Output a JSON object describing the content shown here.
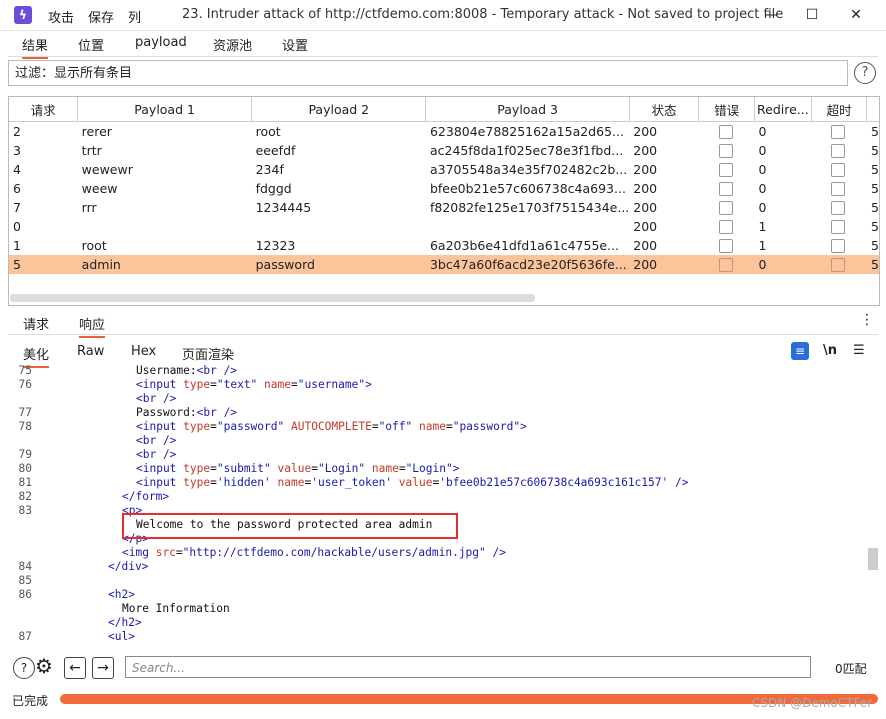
{
  "titlebar": {
    "menu": [
      "攻击",
      "保存",
      "列"
    ],
    "title": "23. Intruder attack of http://ctfdemo.com:8008 - Temporary attack - Not saved to project file",
    "min": "—",
    "max": "☐",
    "close": "✕"
  },
  "tabs": [
    "结果",
    "位置",
    "payload",
    "资源池",
    "设置"
  ],
  "filter": "过滤：显示所有条目",
  "table": {
    "headers": [
      "请求",
      "Payload 1",
      "Payload 2",
      "Payload 3",
      "状态",
      "错误",
      "Redire...",
      "超时"
    ],
    "rows": [
      {
        "req": "2",
        "p1": "rerer",
        "p2": "root",
        "p3": "623804e78825162a15a2d65...",
        "status": "200",
        "redir": "0",
        "extra": "5"
      },
      {
        "req": "3",
        "p1": "trtr",
        "p2": "eeefdf",
        "p3": "ac245f8da1f025ec78e3f1fbd...",
        "status": "200",
        "redir": "0",
        "extra": "5"
      },
      {
        "req": "4",
        "p1": "wewewr",
        "p2": "234f",
        "p3": "a3705548a34e35f702482c2b...",
        "status": "200",
        "redir": "0",
        "extra": "5"
      },
      {
        "req": "6",
        "p1": "weew",
        "p2": "fdggd",
        "p3": "bfee0b21e57c606738c4a693...",
        "status": "200",
        "redir": "0",
        "extra": "5"
      },
      {
        "req": "7",
        "p1": "rrr",
        "p2": "1234445",
        "p3": "f82082fe125e1703f7515434e...",
        "status": "200",
        "redir": "0",
        "extra": "5"
      },
      {
        "req": "0",
        "p1": "",
        "p2": "",
        "p3": "",
        "status": "200",
        "redir": "1",
        "extra": "5"
      },
      {
        "req": "1",
        "p1": "root",
        "p2": "12323",
        "p3": "6a203b6e41dfd1a61c4755e...",
        "status": "200",
        "redir": "1",
        "extra": "5"
      },
      {
        "req": "5",
        "p1": "admin",
        "p2": "password",
        "p3": "3bc47a60f6acd23e20f5636fe...",
        "status": "200",
        "redir": "0",
        "extra": "5",
        "selected": true
      }
    ]
  },
  "panel_tabs": [
    "请求",
    "响应"
  ],
  "sub_tabs": [
    "美化",
    "Raw",
    "Hex",
    "页面渲染"
  ],
  "code_tools": {
    "wrap": "≡",
    "newline": "\\n",
    "menu": "☰"
  },
  "code_lines": [
    {
      "n": "75",
      "indent": 0,
      "html": "Username:<span class='tag'>&lt;br /&gt;</span>"
    },
    {
      "n": "76",
      "indent": 0,
      "html": "<span class='tag'>&lt;input</span> <span class='attr'>type</span>=<span class='val'>\"text\"</span> <span class='attr'>name</span>=<span class='val'>\"username\"</span><span class='tag'>&gt;</span>"
    },
    {
      "n": "",
      "indent": 0,
      "html": "<span class='tag'>&lt;br /&gt;</span>"
    },
    {
      "n": "77",
      "indent": 0,
      "html": "Password:<span class='tag'>&lt;br /&gt;</span>"
    },
    {
      "n": "78",
      "indent": 0,
      "html": "<span class='tag'>&lt;input</span> <span class='attr'>type</span>=<span class='val'>\"password\"</span> <span class='attr'>AUTOCOMPLETE</span>=<span class='val'>\"off\"</span> <span class='attr'>name</span>=<span class='val'>\"password\"</span><span class='tag'>&gt;</span>"
    },
    {
      "n": "",
      "indent": 0,
      "html": "<span class='tag'>&lt;br /&gt;</span>"
    },
    {
      "n": "79",
      "indent": 0,
      "html": "<span class='tag'>&lt;br /&gt;</span>"
    },
    {
      "n": "80",
      "indent": 0,
      "html": "<span class='tag'>&lt;input</span> <span class='attr'>type</span>=<span class='val'>\"submit\"</span> <span class='attr'>value</span>=<span class='val'>\"Login\"</span> <span class='attr'>name</span>=<span class='val'>\"Login\"</span><span class='tag'>&gt;</span>"
    },
    {
      "n": "81",
      "indent": 0,
      "html": "<span class='tag'>&lt;input</span> <span class='attr'>type</span>=<span class='val'>'hidden'</span> <span class='attr'>name</span>=<span class='val'>'user_token'</span> <span class='attr'>value</span>=<span class='val'>'bfee0b21e57c606738c4a693c161c157'</span> <span class='tag'>/&gt;</span>"
    },
    {
      "n": "82",
      "indent": -1,
      "html": "<span class='tag'>&lt;/form&gt;</span>"
    },
    {
      "n": "83",
      "indent": -1,
      "html": "<span class='tag'>&lt;p&gt;</span>"
    },
    {
      "n": "",
      "indent": 0,
      "html": "Welcome to the password protected area admin"
    },
    {
      "n": "",
      "indent": -1,
      "html": "<span class='tag'>&lt;/p&gt;</span>"
    },
    {
      "n": "",
      "indent": -1,
      "html": "<span class='tag'>&lt;img</span> <span class='attr'>src</span>=<span class='val'>\"http://ctfdemo.com/hackable/users/admin.jpg\"</span> <span class='tag'>/&gt;</span>"
    },
    {
      "n": "84",
      "indent": -2,
      "html": "<span class='tag'>&lt;/div&gt;</span>"
    },
    {
      "n": "85",
      "indent": -2,
      "html": ""
    },
    {
      "n": "86",
      "indent": -2,
      "html": "<span class='tag'>&lt;h2&gt;</span>"
    },
    {
      "n": "",
      "indent": -1,
      "html": "More Information"
    },
    {
      "n": "",
      "indent": -2,
      "html": "<span class='tag'>&lt;/h2&gt;</span>"
    },
    {
      "n": "87",
      "indent": -2,
      "html": "<span class='tag'>&lt;ul&gt;</span>"
    }
  ],
  "search": {
    "placeholder": "Search..."
  },
  "match_count": "0匹配",
  "status": "已完成",
  "progress": 1.0,
  "watermark": "CSDN @DemoCTFer"
}
